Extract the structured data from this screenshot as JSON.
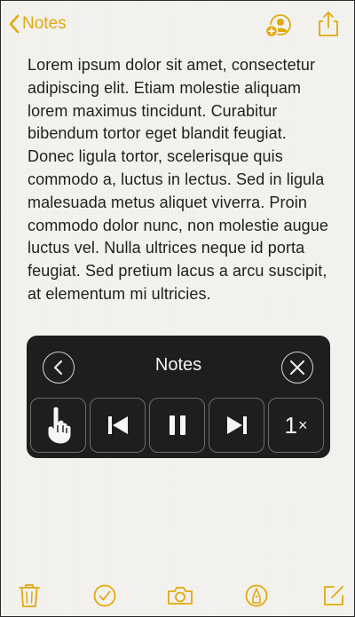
{
  "nav": {
    "back_label": "Notes",
    "icons": [
      "chevron-left-icon",
      "add-person-icon",
      "share-icon"
    ]
  },
  "note": {
    "body": " Lorem ipsum dolor sit amet, consectetur adipiscing elit. Etiam molestie aliquam lorem maximus tincidunt. Curabitur bibendum tortor eget blandit feugiat. Donec ligula tortor, scelerisque quis commodo a, luctus in lectus. Sed in ligula malesuada metus aliquet viverra. Proin commodo dolor nunc, non molestie augue luctus vel. Nulla ultrices neque id porta feugiat. Sed pretium lacus a arcu suscipit, at elementum mi ultricies."
  },
  "speech_controller": {
    "title": "Notes",
    "speed": "1",
    "speed_unit": "×",
    "icons": [
      "back-icon",
      "close-icon",
      "pointer-hand-icon",
      "skip-back-icon",
      "pause-icon",
      "skip-forward-icon"
    ]
  },
  "toolbar": {
    "icons": [
      "trash-icon",
      "checklist-icon",
      "camera-icon",
      "markup-pen-icon",
      "compose-icon"
    ]
  },
  "colors": {
    "accent": "#e2a80d",
    "panel_bg": "#1e1e1e",
    "paper_bg": "#f4f3ef"
  }
}
